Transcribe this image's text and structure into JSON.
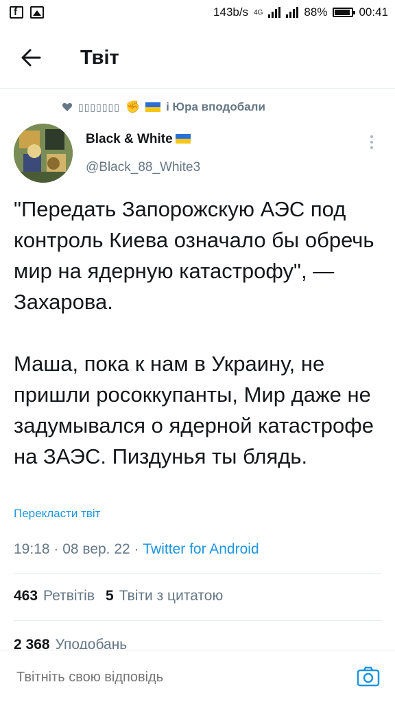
{
  "status_bar": {
    "speed": "143b/s",
    "network": "4G",
    "battery": "88%",
    "time": "00:41"
  },
  "header": {
    "title": "Твіт"
  },
  "social_context": {
    "boxes": "▯▯▯▯▯▯▯",
    "text": "і Юра вподобали"
  },
  "author": {
    "name": "Black & White",
    "handle": "@Black_88_White3"
  },
  "tweet": {
    "paragraph1": "\"Передать Запорожскую АЭС под контроль Киева означало бы обречь мир на ядерную катастрофу\", — Захарова.",
    "paragraph2": "Маша, пока к нам в Украину, не пришли росоккупанты, Мир даже не задумывался о ядерной катастрофе на ЗАЭС. Пиздунья ты блядь.",
    "translate": "Перекласти твіт",
    "time": "19:18 · 08 вер. 22 ·",
    "client": "Twitter for Android"
  },
  "stats": {
    "retweets_count": "463",
    "retweets_label": "Ретвітів",
    "quotes_count": "5",
    "quotes_label": "Твіти з цитатою",
    "likes_count": "2 368",
    "likes_label": "Уподобань"
  },
  "reply": {
    "placeholder": "Твітніть свою відповідь"
  },
  "colors": {
    "accent": "#1b95e0",
    "muted": "#657786",
    "text": "#14171a"
  }
}
